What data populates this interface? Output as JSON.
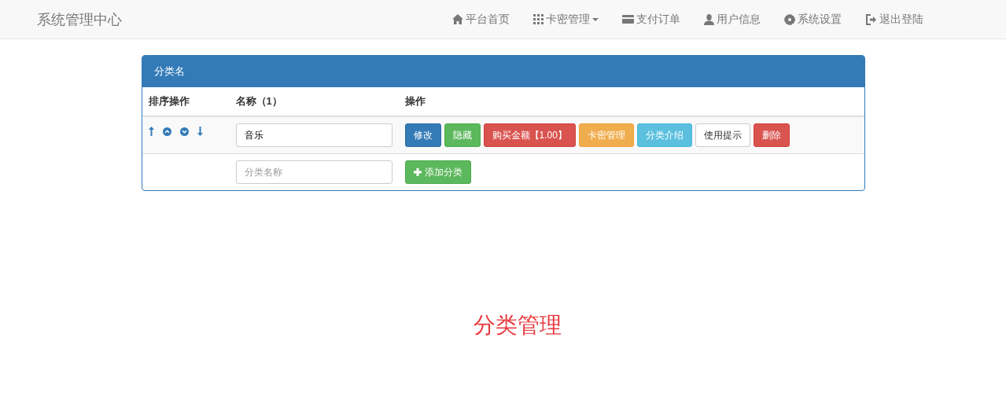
{
  "navbar": {
    "brand": "系统管理中心",
    "items": [
      {
        "kind": "home",
        "label": "平台首页",
        "dropdown": false
      },
      {
        "kind": "grid",
        "label": "卡密管理",
        "dropdown": true
      },
      {
        "kind": "card",
        "label": "支付订单",
        "dropdown": false
      },
      {
        "kind": "user",
        "label": "用户信息",
        "dropdown": false
      },
      {
        "kind": "gear",
        "label": "系统设置",
        "dropdown": false
      },
      {
        "kind": "logout",
        "label": "退出登陆",
        "dropdown": false
      }
    ]
  },
  "panel": {
    "title": "分类名",
    "columns": [
      "排序操作",
      "名称（1）",
      "操作"
    ],
    "rows": [
      {
        "name": "音乐",
        "actions": [
          {
            "kind": "primary",
            "label": "修改"
          },
          {
            "kind": "success",
            "label": "隐藏"
          },
          {
            "kind": "danger",
            "label": "购买金额【1.00】"
          },
          {
            "kind": "warning",
            "label": "卡密管理"
          },
          {
            "kind": "info",
            "label": "分类介绍"
          },
          {
            "kind": "default",
            "label": "使用提示"
          },
          {
            "kind": "danger",
            "label": "删除"
          }
        ]
      }
    ],
    "new_row": {
      "placeholder": "分类名称",
      "button": "添加分类"
    }
  },
  "footer": {
    "title": "分类管理"
  }
}
